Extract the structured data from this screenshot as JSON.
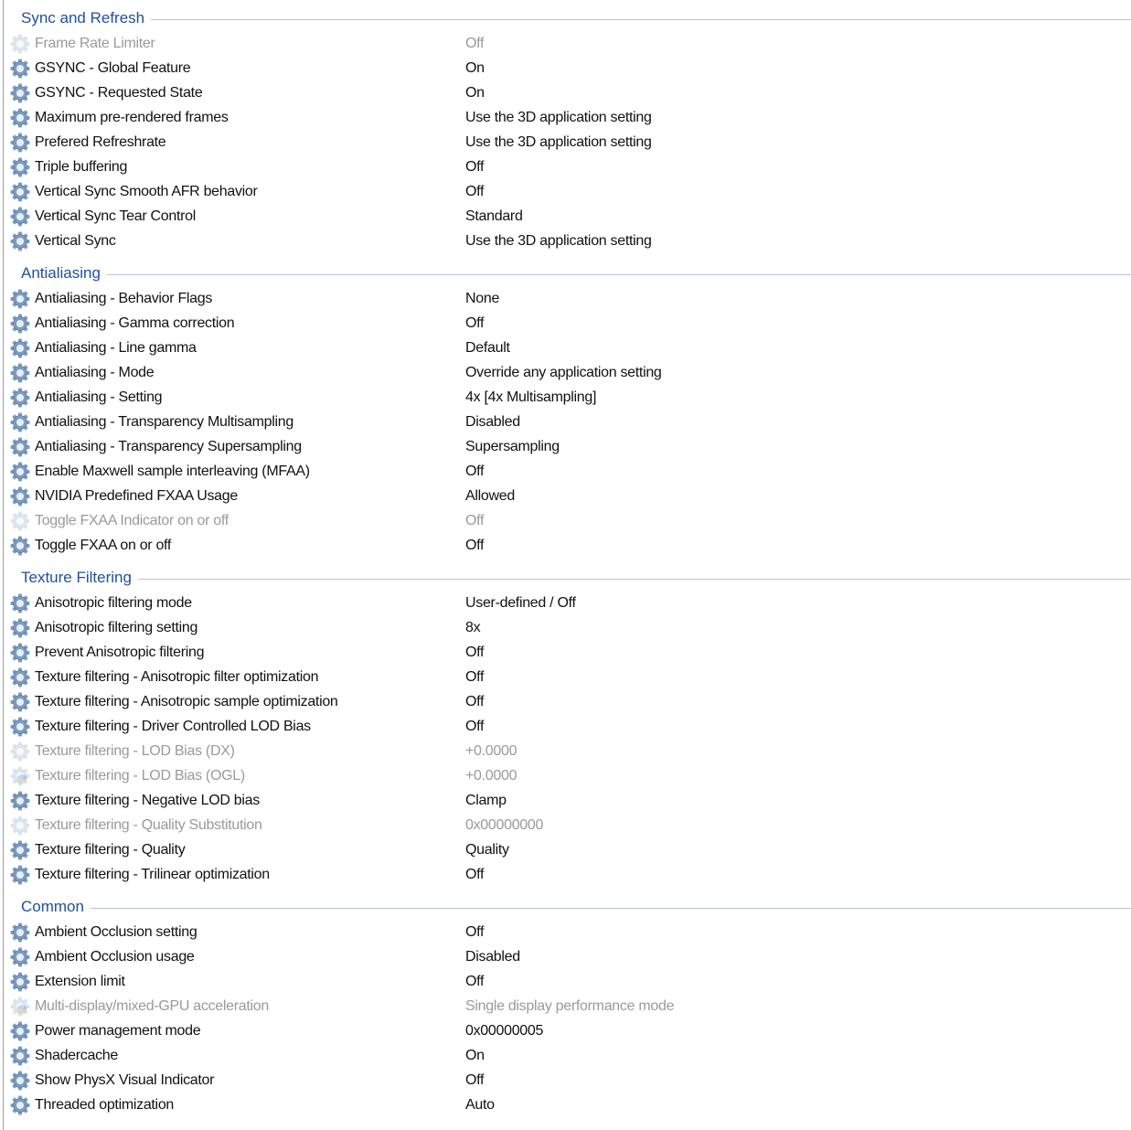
{
  "colors": {
    "group_title": "#1e50a2",
    "gear": "#7d9cc0",
    "disabled_text": "#9a9a9a"
  },
  "groups": [
    {
      "title": "Sync and Refresh",
      "items": [
        {
          "name": "Frame Rate Limiter",
          "value": "Off",
          "state": "disabled",
          "icon": "gear-icon"
        },
        {
          "name": "GSYNC - Global Feature",
          "value": "On",
          "state": "normal",
          "icon": "gear-icon"
        },
        {
          "name": "GSYNC - Requested State",
          "value": "On",
          "state": "normal",
          "icon": "gear-icon"
        },
        {
          "name": "Maximum pre-rendered frames",
          "value": "Use the 3D application setting",
          "state": "normal",
          "icon": "gear-icon"
        },
        {
          "name": "Prefered Refreshrate",
          "value": "Use the 3D application setting",
          "state": "normal",
          "icon": "gear-icon"
        },
        {
          "name": "Triple buffering",
          "value": "Off",
          "state": "normal",
          "icon": "gear-icon"
        },
        {
          "name": "Vertical Sync Smooth AFR behavior",
          "value": "Off",
          "state": "normal",
          "icon": "gear-icon"
        },
        {
          "name": "Vertical Sync Tear Control",
          "value": "Standard",
          "state": "normal",
          "icon": "gear-icon"
        },
        {
          "name": "Vertical Sync",
          "value": "Use the 3D application setting",
          "state": "normal",
          "icon": "gear-icon"
        }
      ]
    },
    {
      "title": "Antialiasing",
      "items": [
        {
          "name": "Antialiasing - Behavior Flags",
          "value": "None",
          "state": "normal",
          "icon": "gear-icon"
        },
        {
          "name": "Antialiasing - Gamma correction",
          "value": "Off",
          "state": "normal",
          "icon": "gear-icon"
        },
        {
          "name": "Antialiasing - Line gamma",
          "value": "Default",
          "state": "normal",
          "icon": "gear-icon"
        },
        {
          "name": "Antialiasing - Mode",
          "value": "Override any application setting",
          "state": "normal",
          "icon": "gear-icon"
        },
        {
          "name": "Antialiasing - Setting",
          "value": "4x [4x Multisampling]",
          "state": "normal",
          "icon": "gear-icon"
        },
        {
          "name": "Antialiasing - Transparency Multisampling",
          "value": "Disabled",
          "state": "normal",
          "icon": "gear-icon"
        },
        {
          "name": "Antialiasing - Transparency Supersampling",
          "value": "Supersampling",
          "state": "normal",
          "icon": "gear-icon"
        },
        {
          "name": "Enable Maxwell sample interleaving (MFAA)",
          "value": "Off",
          "state": "normal",
          "icon": "gear-icon"
        },
        {
          "name": "NVIDIA Predefined FXAA Usage",
          "value": "Allowed",
          "state": "normal",
          "icon": "gear-icon"
        },
        {
          "name": "Toggle FXAA Indicator on or off",
          "value": "Off",
          "state": "disabled",
          "icon": "gear-icon"
        },
        {
          "name": "Toggle FXAA on or off",
          "value": "Off",
          "state": "normal",
          "icon": "gear-icon"
        }
      ]
    },
    {
      "title": "Texture Filtering",
      "items": [
        {
          "name": "Anisotropic filtering mode",
          "value": "User-defined / Off",
          "state": "normal",
          "icon": "gear-icon"
        },
        {
          "name": "Anisotropic filtering setting",
          "value": "8x",
          "state": "normal",
          "icon": "gear-icon"
        },
        {
          "name": "Prevent Anisotropic filtering",
          "value": "Off",
          "state": "normal",
          "icon": "gear-icon"
        },
        {
          "name": "Texture filtering - Anisotropic filter optimization",
          "value": "Off",
          "state": "normal",
          "icon": "gear-icon"
        },
        {
          "name": "Texture filtering - Anisotropic sample optimization",
          "value": "Off",
          "state": "normal",
          "icon": "gear-icon"
        },
        {
          "name": "Texture filtering - Driver Controlled LOD Bias",
          "value": "Off",
          "state": "normal",
          "icon": "gear-icon"
        },
        {
          "name": "Texture filtering - LOD Bias (DX)",
          "value": "+0.0000",
          "state": "disabled",
          "icon": "gear-icon"
        },
        {
          "name": "Texture filtering - LOD Bias (OGL)",
          "value": "+0.0000",
          "state": "disabled",
          "icon": "shield-gear-icon"
        },
        {
          "name": "Texture filtering - Negative LOD bias",
          "value": "Clamp",
          "state": "normal",
          "icon": "gear-icon"
        },
        {
          "name": "Texture filtering - Quality Substitution",
          "value": "0x00000000",
          "state": "disabled",
          "icon": "gear-icon"
        },
        {
          "name": "Texture filtering - Quality",
          "value": "Quality",
          "state": "normal",
          "icon": "gear-icon"
        },
        {
          "name": "Texture filtering - Trilinear optimization",
          "value": "Off",
          "state": "normal",
          "icon": "gear-icon"
        }
      ]
    },
    {
      "title": "Common",
      "items": [
        {
          "name": "Ambient Occlusion setting",
          "value": "Off",
          "state": "normal",
          "icon": "gear-icon"
        },
        {
          "name": "Ambient Occlusion usage",
          "value": "Disabled",
          "state": "normal",
          "icon": "gear-icon"
        },
        {
          "name": "Extension limit",
          "value": "Off",
          "state": "normal",
          "icon": "gear-icon"
        },
        {
          "name": "Multi-display/mixed-GPU acceleration",
          "value": "Single display performance mode",
          "state": "disabled",
          "icon": "shield-gear-icon"
        },
        {
          "name": "Power management mode",
          "value": "0x00000005",
          "state": "normal",
          "icon": "gear-icon"
        },
        {
          "name": "Shadercache",
          "value": "On",
          "state": "normal",
          "icon": "gear-icon"
        },
        {
          "name": "Show PhysX Visual Indicator",
          "value": "Off",
          "state": "normal",
          "icon": "gear-icon"
        },
        {
          "name": "Threaded optimization",
          "value": "Auto",
          "state": "normal",
          "icon": "gear-icon"
        }
      ]
    }
  ]
}
